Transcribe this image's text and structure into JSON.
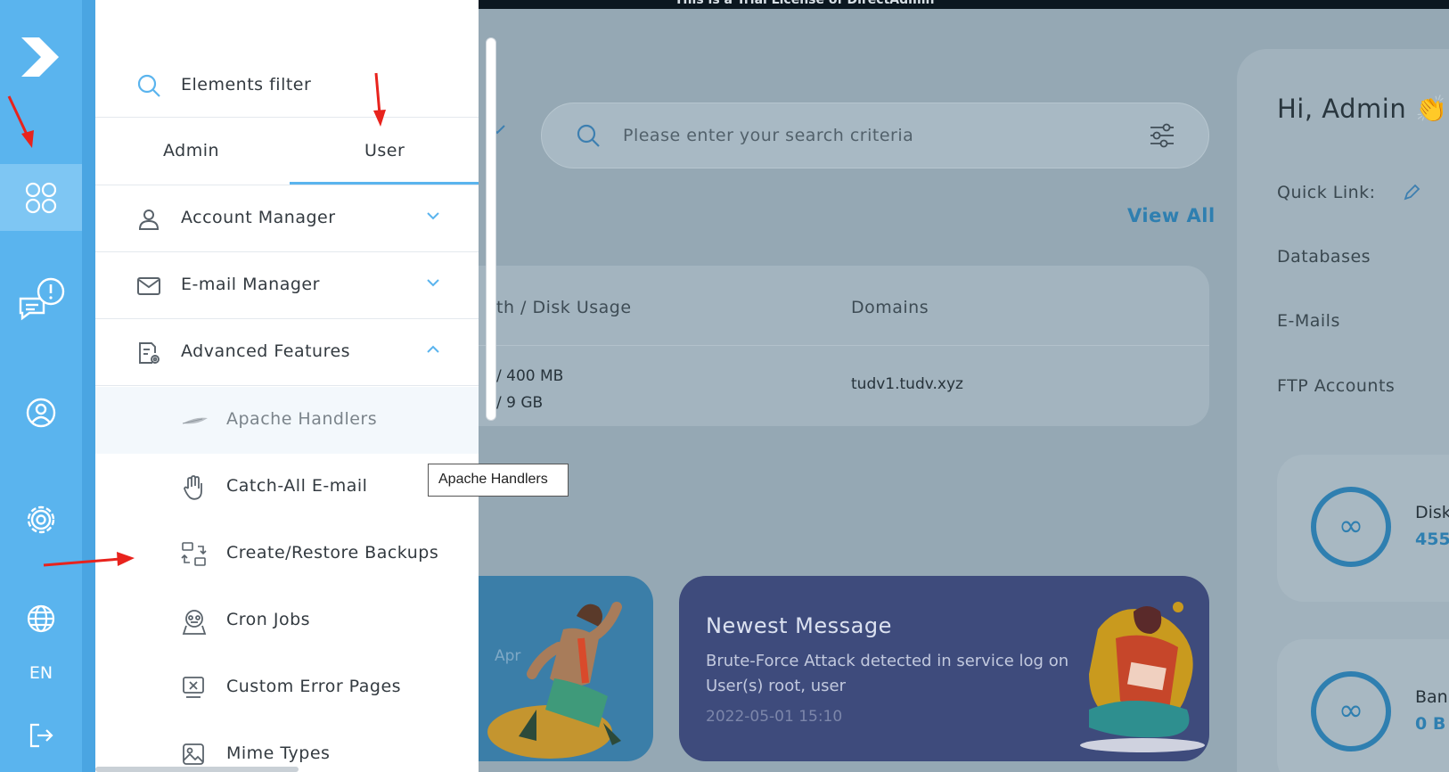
{
  "banner": {
    "text": "This is a Trial License of DirectAdmin"
  },
  "rail": {
    "language": "EN",
    "items": [
      {
        "icon": "logo-icon"
      },
      {
        "icon": "grid-icon",
        "active": true
      },
      {
        "icon": "message-alert-icon"
      },
      {
        "icon": "user-circle-icon"
      },
      {
        "icon": "gear-icon"
      },
      {
        "icon": "globe-icon"
      },
      {
        "icon": "logout-icon"
      }
    ]
  },
  "drawer": {
    "filter_label": "Elements filter",
    "tabs": [
      {
        "label": "Admin",
        "active": false
      },
      {
        "label": "User",
        "active": true
      }
    ],
    "menu": [
      {
        "label": "Account Manager",
        "icon": "person-icon",
        "expanded": false
      },
      {
        "label": "E-mail Manager",
        "icon": "mail-icon",
        "expanded": false
      },
      {
        "label": "Advanced Features",
        "icon": "document-gear-icon",
        "expanded": true
      }
    ],
    "submenu": [
      {
        "label": "Apache Handlers",
        "icon": "feather-icon",
        "active": true
      },
      {
        "label": "Catch-All E-mail",
        "icon": "hand-icon",
        "active": false
      },
      {
        "label": "Create/Restore Backups",
        "icon": "backup-icon",
        "active": false
      },
      {
        "label": "Cron Jobs",
        "icon": "cron-icon",
        "active": false
      },
      {
        "label": "Custom Error Pages",
        "icon": "error-page-icon",
        "active": false
      },
      {
        "label": "Mime Types",
        "icon": "image-icon",
        "active": false
      }
    ]
  },
  "tooltip": {
    "text": "Apache Handlers"
  },
  "background": {
    "search_placeholder": "Please enter your search criteria",
    "view_all": "View All",
    "table": {
      "headers": [
        "th / Disk Usage",
        "Domains"
      ],
      "usage_line1": "/  400 MB",
      "usage_line2": "/  9 GB",
      "domain": "tudv1.tudv.xyz"
    },
    "card_left_text": "Apr",
    "newest_message": {
      "title": "Newest Message",
      "body": "Brute-Force Attack detected in service log on User(s) root, user",
      "date": "2022-05-01 15:10"
    },
    "greeting": "Hi, Admin 👏",
    "quick_link_label": "Quick Link:",
    "quick_links": [
      "Databases",
      "E-Mails",
      "FTP Accounts"
    ],
    "stats": [
      {
        "label": "Disk",
        "value": "455",
        "symbol": "∞"
      },
      {
        "label": "Ban",
        "value": "0 B",
        "symbol": "∞"
      }
    ]
  },
  "colors": {
    "rail": "#5ab4ee",
    "accent": "#5ab4ee",
    "annotation_arrow": "#e8231d",
    "message_card": "#3e4b7c"
  }
}
